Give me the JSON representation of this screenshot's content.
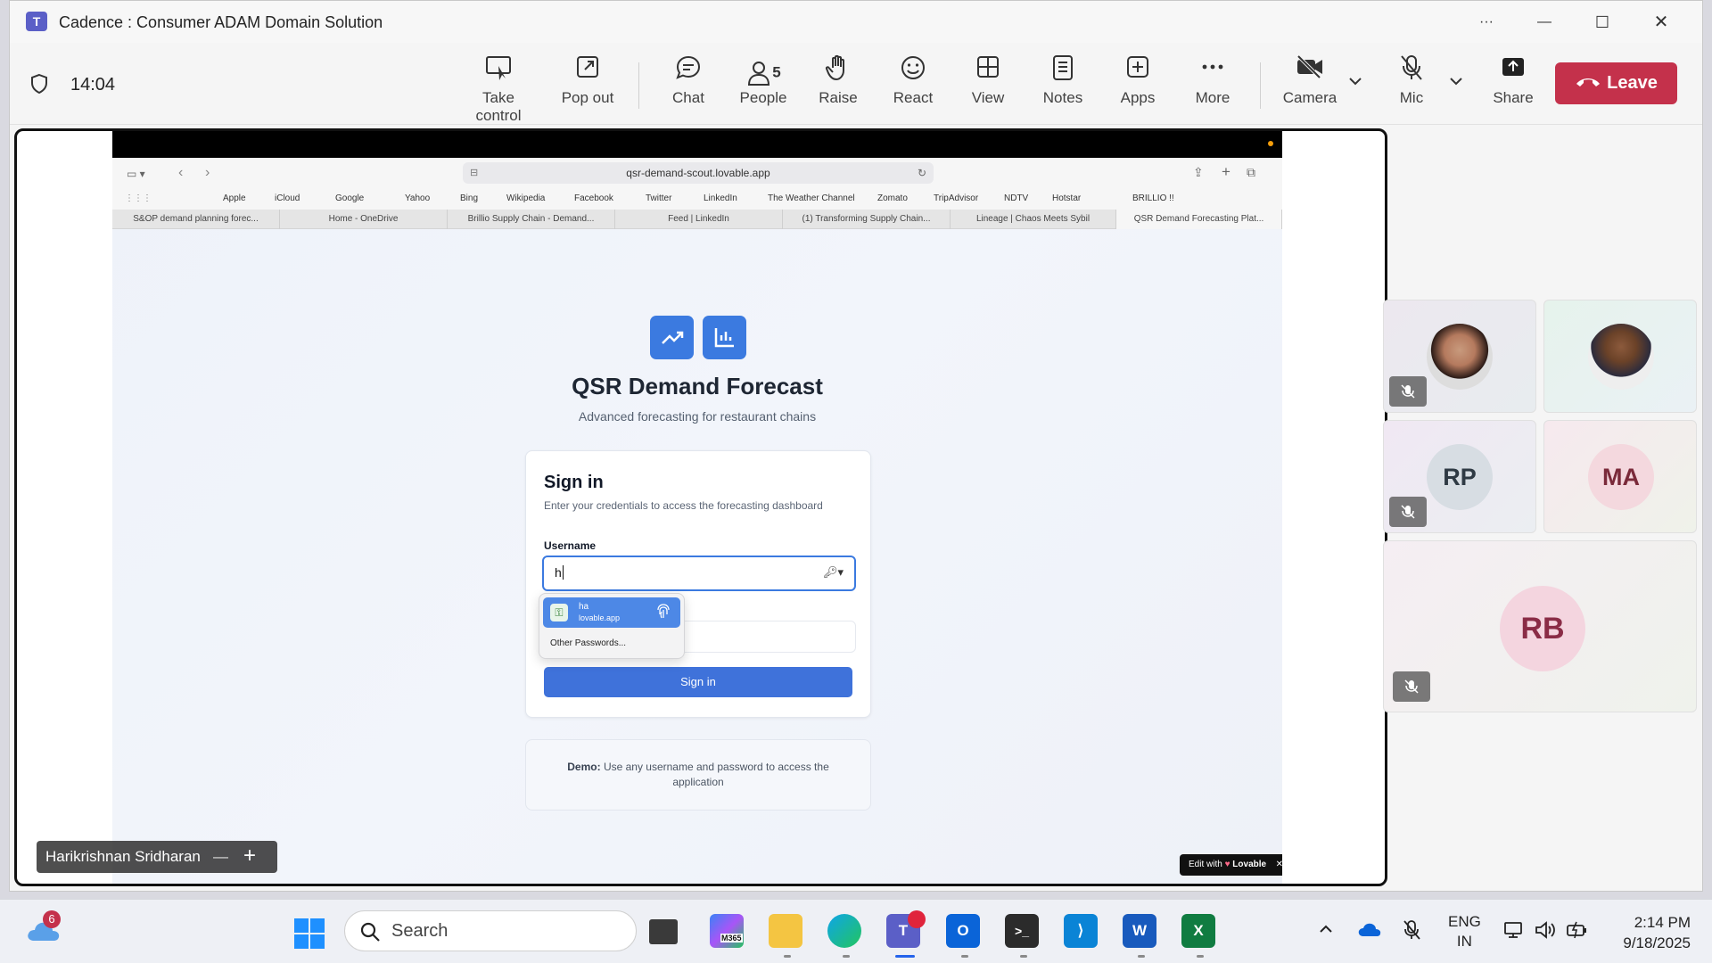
{
  "window": {
    "title": "Cadence : Consumer ADAM Domain Solution",
    "controls": {
      "more": "···",
      "minimize": "—",
      "maximize": "☐",
      "close": "✕"
    }
  },
  "meeting": {
    "clock": "14:04",
    "toolbar": {
      "take_control": "Take control",
      "pop_out": "Pop out",
      "chat": "Chat",
      "people": "People",
      "people_count": "5",
      "raise": "Raise",
      "react": "React",
      "view": "View",
      "notes": "Notes",
      "apps": "Apps",
      "more": "More",
      "camera": "Camera",
      "mic": "Mic",
      "share": "Share",
      "leave": "Leave"
    },
    "presenter": "Harikrishnan Sridharan",
    "presenter_minus": "—",
    "presenter_plus": "+",
    "participants": [
      {
        "initials": "",
        "muted": true
      },
      {
        "initials": "",
        "muted": false
      },
      {
        "initials": "RP",
        "muted": true
      },
      {
        "initials": "MA",
        "muted": false
      },
      {
        "initials": "RB",
        "muted": true
      }
    ],
    "colors": {
      "leave": "#c4314b",
      "accent": "#5b5fc7"
    }
  },
  "browser": {
    "url": "qsr-demand-scout.lovable.app",
    "bookmarks": [
      "Apple",
      "iCloud",
      "Google",
      "Yahoo",
      "Bing",
      "Wikipedia",
      "Facebook",
      "Twitter",
      "LinkedIn",
      "The Weather Channel",
      "Zomato",
      "TripAdvisor",
      "NDTV",
      "Hotstar",
      "BRILLIO !!"
    ],
    "tabs": [
      "S&OP demand planning forec...",
      "Home - OneDrive",
      "Brillio Supply Chain - Demand...",
      "Feed | LinkedIn",
      "(1) Transforming Supply Chain...",
      "Lineage | Chaos Meets Sybil",
      "QSR Demand Forecasting Plat..."
    ]
  },
  "app": {
    "title": "QSR Demand Forecast",
    "subtitle": "Advanced forecasting for restaurant chains",
    "signin": {
      "heading": "Sign in",
      "description": "Enter your credentials to access the forecasting dashboard",
      "username_label": "Username",
      "username_value": "h",
      "button": "Sign in"
    },
    "autofill": {
      "user": "ha",
      "domain": "lovable.app",
      "other": "Other Passwords..."
    },
    "demo_label": "Demo:",
    "demo_text": "Use any username and password to access the application",
    "badge": "Edit with",
    "badge_brand": "Lovable",
    "badge_close": "✕"
  },
  "taskbar": {
    "weather_badge": "6",
    "search_placeholder": "Search",
    "m365_label": "M365",
    "lang_top": "ENG",
    "lang_bottom": "IN",
    "time": "2:14 PM",
    "date": "9/18/2025"
  }
}
